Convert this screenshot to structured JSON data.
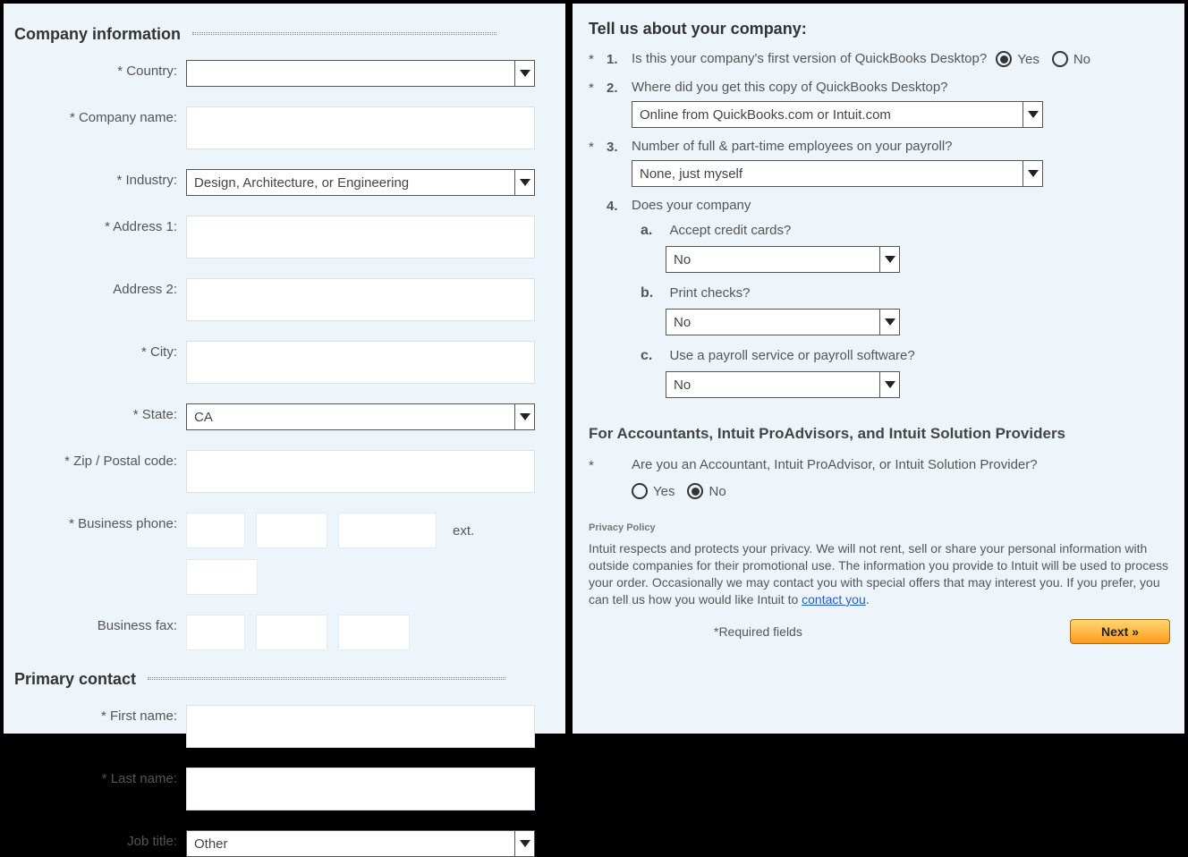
{
  "left": {
    "section1_title": "Company information",
    "labels": {
      "country": "* Country:",
      "company_name": "* Company name:",
      "industry": "* Industry:",
      "address1": "* Address 1:",
      "address2": "Address 2:",
      "city": "* City:",
      "state": "* State:",
      "zip": "* Zip / Postal code:",
      "business_phone": "* Business phone:",
      "ext": "ext.",
      "business_fax": "Business fax:"
    },
    "values": {
      "country": "",
      "company_name": "",
      "industry": "Design, Architecture, or Engineering",
      "address1": "",
      "address2": "",
      "city": "",
      "state": "CA",
      "zip": ""
    },
    "section2_title": "Primary contact",
    "labels2": {
      "first_name": "* First name:",
      "last_name": "* Last name:",
      "job_title": "Job title:"
    },
    "values2": {
      "first_name": "",
      "last_name": "",
      "job_title": "Other"
    }
  },
  "right": {
    "section_title": "Tell us about your company:",
    "q1": {
      "num": "1.",
      "text": "Is this your company's first version of QuickBooks Desktop?",
      "yes": "Yes",
      "no": "No",
      "selected": "yes"
    },
    "q2": {
      "num": "2.",
      "text": "Where did you get this copy of QuickBooks Desktop?",
      "value": "Online from QuickBooks.com or Intuit.com"
    },
    "q3": {
      "num": "3.",
      "text": "Number of full & part-time employees on your payroll?",
      "value": "None, just myself"
    },
    "q4": {
      "num": "4.",
      "text": "Does your company",
      "a": {
        "letter": "a.",
        "text": "Accept credit cards?",
        "value": "No"
      },
      "b": {
        "letter": "b.",
        "text": "Print checks?",
        "value": "No"
      },
      "c": {
        "letter": "c.",
        "text": "Use a payroll service or payroll software?",
        "value": "No"
      }
    },
    "acc": {
      "title": "For Accountants, Intuit ProAdvisors, and Intuit Solution Providers",
      "question": "Are you an Accountant, Intuit ProAdvisor, or Intuit Solution Provider?",
      "yes": "Yes",
      "no": "No",
      "selected": "no"
    },
    "privacy": {
      "label": "Privacy Policy",
      "text_pre": "Intuit respects and protects your privacy. We will not rent, sell or share your personal information with outside companies for their promotional use. The information you provide to Intuit will be used to process your order. Occasionally we may contact you with special offers that may interest you. If you prefer, you can tell us how you would like Intuit to ",
      "link_text": "contact you",
      "text_post": "."
    },
    "footer": {
      "required_note": "*Required fields",
      "next_label": "Next »"
    }
  }
}
